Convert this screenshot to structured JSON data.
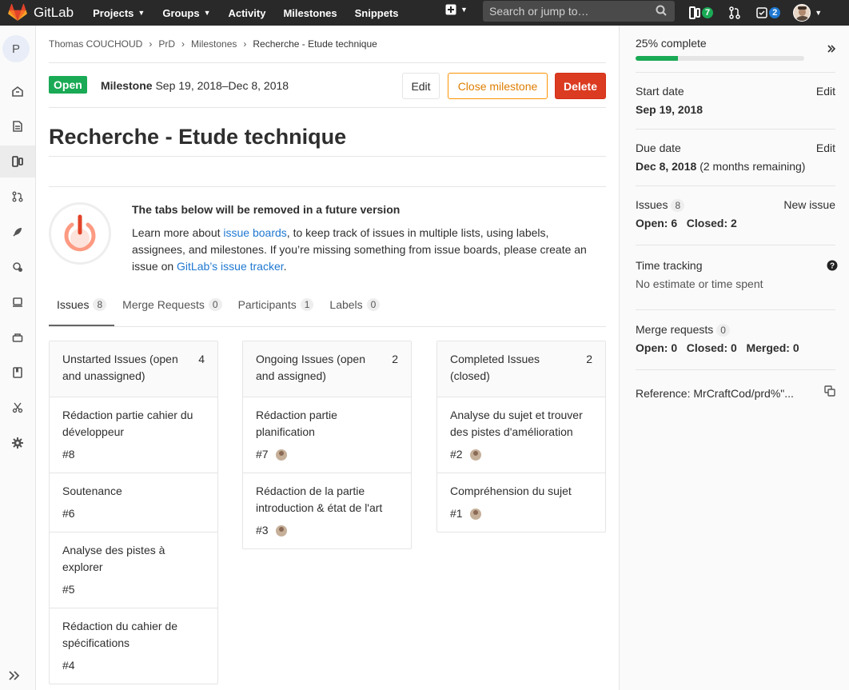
{
  "navbar": {
    "brand": "GitLab",
    "links": [
      {
        "label": "Projects",
        "dropdown": true
      },
      {
        "label": "Groups",
        "dropdown": true
      },
      {
        "label": "Activity",
        "dropdown": false
      },
      {
        "label": "Milestones",
        "dropdown": false
      },
      {
        "label": "Snippets",
        "dropdown": false
      }
    ],
    "search_placeholder": "Search or jump to…",
    "issues_badge": "7",
    "todos_badge": "2"
  },
  "sidebar": {
    "project_initial": "P"
  },
  "breadcrumb": [
    "Thomas COUCHOUD",
    "PrD",
    "Milestones",
    "Recherche - Etude technique"
  ],
  "milestone": {
    "status": "Open",
    "label": "Milestone",
    "dates": "Sep 19, 2018–Dec 8, 2018",
    "edit_label": "Edit",
    "close_label": "Close milestone",
    "delete_label": "Delete",
    "title": "Recherche - Etude technique"
  },
  "notice": {
    "title": "The tabs below will be removed in a future version",
    "text_1": "Learn more about ",
    "link_1": "issue boards",
    "text_2": ", to keep track of issues in multiple lists, using labels, assignees, and milestones. If you’re missing something from issue boards, please create an issue on ",
    "link_2": "GitLab’s issue tracker",
    "text_3": "."
  },
  "tabs": [
    {
      "label": "Issues",
      "count": "8"
    },
    {
      "label": "Merge Requests",
      "count": "0"
    },
    {
      "label": "Participants",
      "count": "1"
    },
    {
      "label": "Labels",
      "count": "0"
    }
  ],
  "columns": [
    {
      "title": "Unstarted Issues (open and unassigned)",
      "count": "4",
      "items": [
        {
          "title": "Rédaction partie cahier du développeur",
          "number": "#8"
        },
        {
          "title": "Soutenance",
          "number": "#6"
        },
        {
          "title": "Analyse des pistes à explorer",
          "number": "#5"
        },
        {
          "title": "Rédaction du cahier de spécifications",
          "number": "#4"
        }
      ]
    },
    {
      "title": "Ongoing Issues (open and assigned)",
      "count": "2",
      "items": [
        {
          "title": "Rédaction partie planification",
          "number": "#7"
        },
        {
          "title": "Rédaction de la partie introduction & état de l'art",
          "number": "#3"
        }
      ]
    },
    {
      "title": "Completed Issues (closed)",
      "count": "2",
      "items": [
        {
          "title": "Analyse du sujet et trouver des pistes d'amélioration",
          "number": "#2"
        },
        {
          "title": "Compréhension du sujet",
          "number": "#1"
        }
      ]
    }
  ],
  "right_sidebar": {
    "progress_text": "25% complete",
    "progress_percent": 25,
    "start_label": "Start date",
    "start_value": "Sep 19, 2018",
    "due_label": "Due date",
    "due_value": "Dec 8, 2018",
    "due_remaining": "(2 months remaining)",
    "edit_label": "Edit",
    "issues_label": "Issues",
    "issues_count": "8",
    "new_issue_label": "New issue",
    "issues_open": "Open: 6",
    "issues_closed": "Closed: 2",
    "time_tracking_label": "Time tracking",
    "time_tracking_value": "No estimate or time spent",
    "mr_label": "Merge requests",
    "mr_count": "0",
    "mr_open": "Open: 0",
    "mr_closed": "Closed: 0",
    "mr_merged": "Merged: 0",
    "reference": "Reference: MrCraftCod/prd%\"..."
  },
  "colors": {
    "green": "#1aaa55",
    "orange": "#fc9403",
    "red": "#db3b21",
    "link": "#1f78d1",
    "navbar": "#292929"
  }
}
